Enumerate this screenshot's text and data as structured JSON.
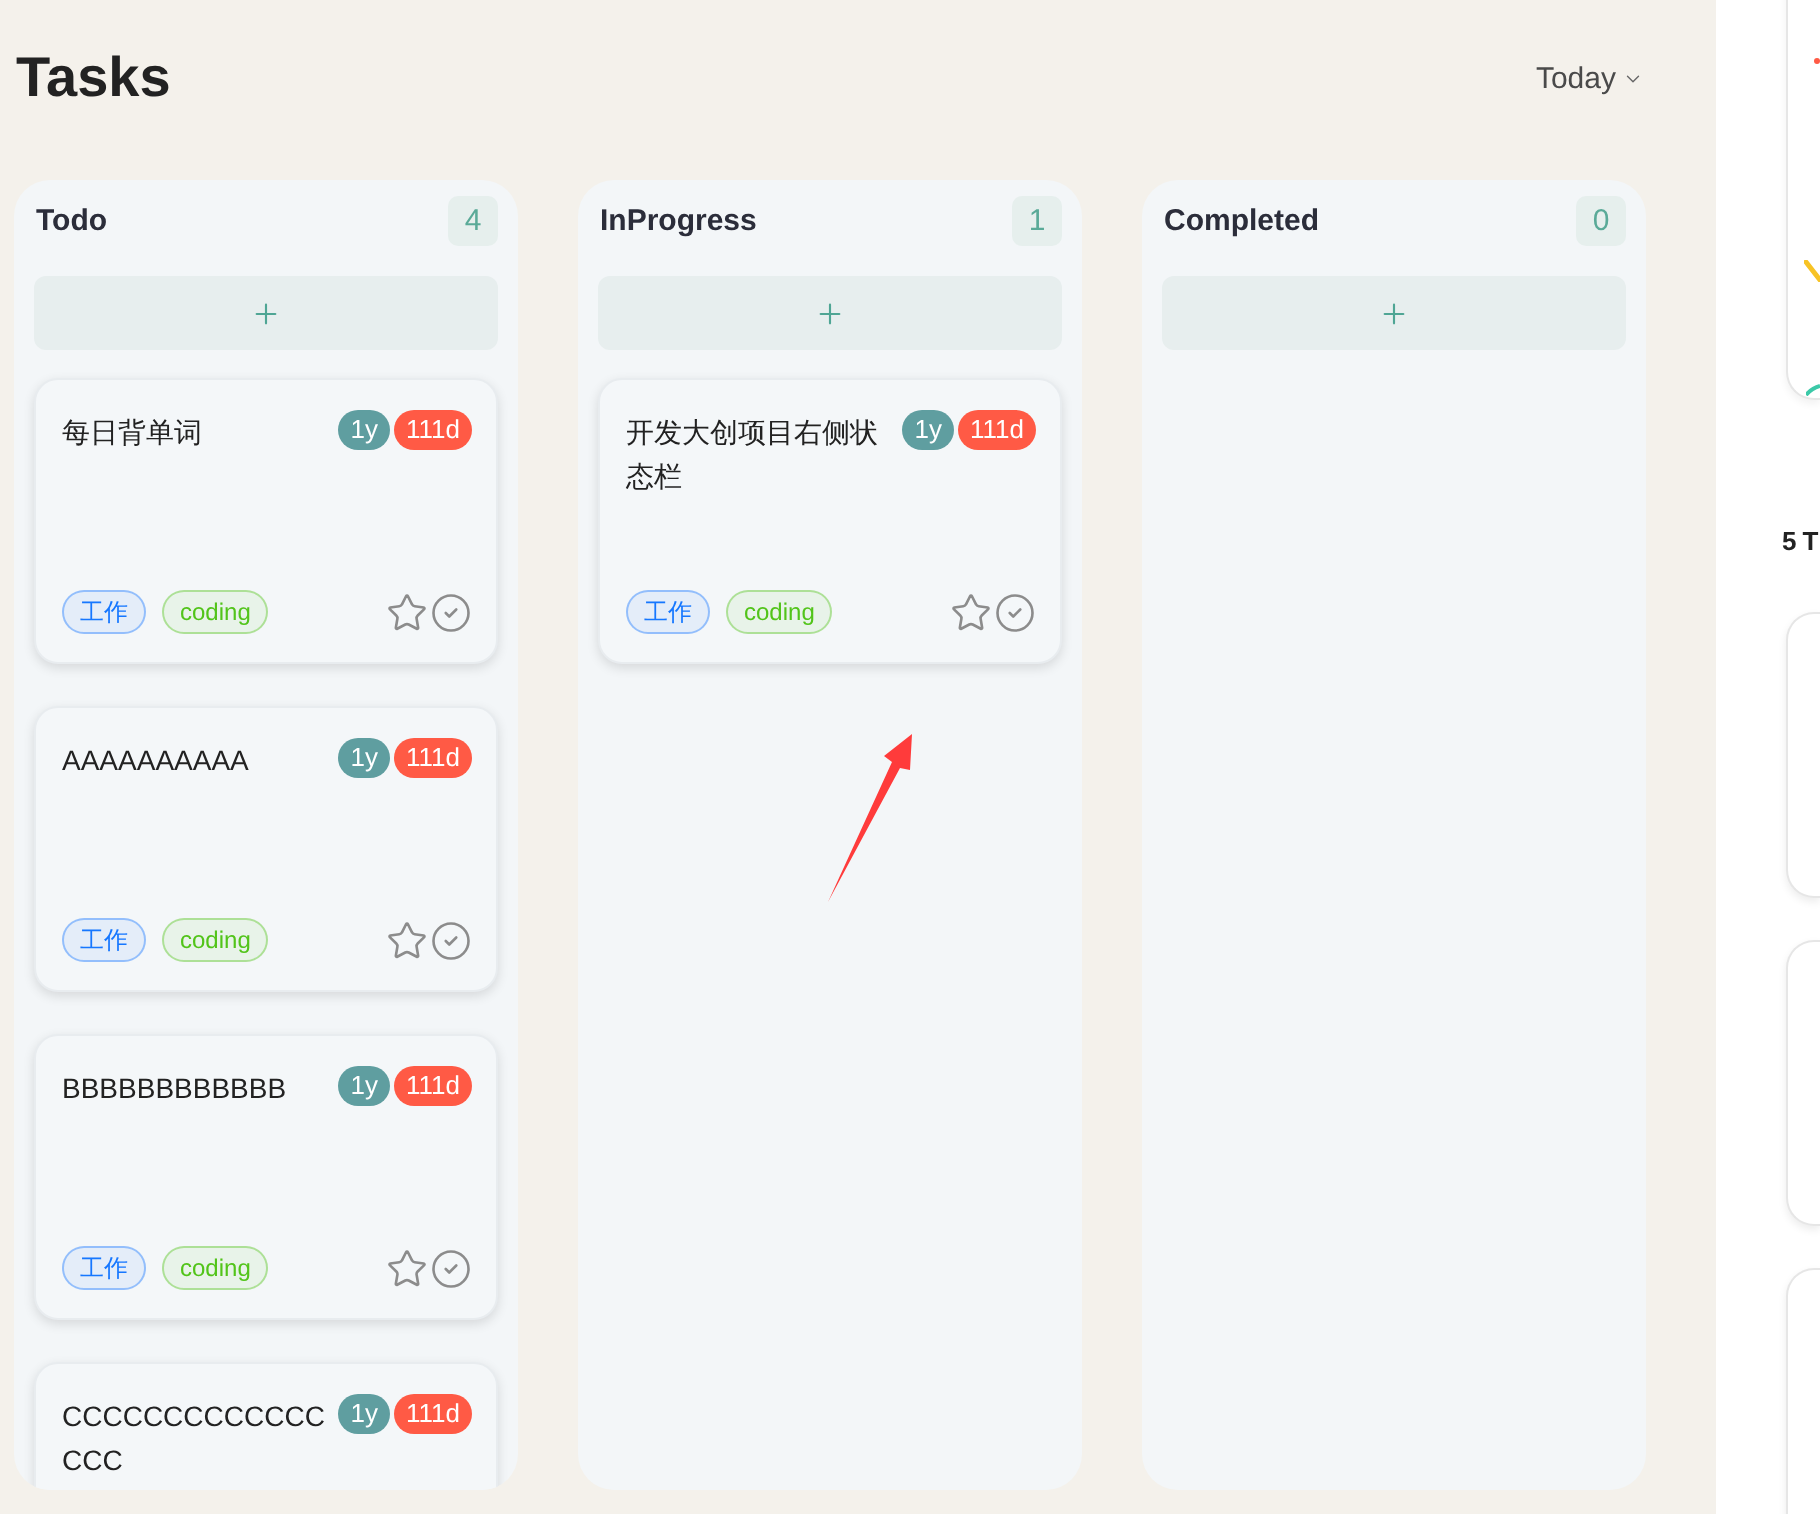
{
  "header": {
    "title": "Tasks",
    "filter": {
      "label": "Today"
    }
  },
  "columns": [
    {
      "title": "Todo",
      "count": "4",
      "cards": [
        {
          "title": "每日背单词",
          "badges": [
            {
              "text": "1y",
              "color": "#5f9ea0"
            },
            {
              "text": "111d",
              "color": "#ff5a45"
            }
          ],
          "tags": [
            {
              "label": "工作",
              "color": "#1677ff"
            },
            {
              "label": "coding",
              "color": "#52c41a"
            }
          ],
          "starred": false,
          "done": false
        },
        {
          "title": "AAAAAAAAAA",
          "badges": [
            {
              "text": "1y",
              "color": "#5f9ea0"
            },
            {
              "text": "111d",
              "color": "#ff5a45"
            }
          ],
          "tags": [
            {
              "label": "工作",
              "color": "#1677ff"
            },
            {
              "label": "coding",
              "color": "#52c41a"
            }
          ],
          "starred": false,
          "done": false
        },
        {
          "title": "BBBBBBBBBBBB",
          "badges": [
            {
              "text": "1y",
              "color": "#5f9ea0"
            },
            {
              "text": "111d",
              "color": "#ff5a45"
            }
          ],
          "tags": [
            {
              "label": "工作",
              "color": "#1677ff"
            },
            {
              "label": "coding",
              "color": "#52c41a"
            }
          ],
          "starred": false,
          "done": false
        },
        {
          "title": "CCCCCCCCCCCCCCCC",
          "badges": [
            {
              "text": "1y",
              "color": "#5f9ea0"
            },
            {
              "text": "111d",
              "color": "#ff5a45"
            }
          ]
        }
      ]
    },
    {
      "title": "InProgress",
      "count": "1",
      "cards": [
        {
          "title": "开发大创项目右侧状态栏",
          "badges": [
            {
              "text": "1y",
              "color": "#5f9ea0"
            },
            {
              "text": "111d",
              "color": "#ff5a45"
            }
          ],
          "tags": [
            {
              "label": "工作",
              "color": "#1677ff"
            },
            {
              "label": "coding",
              "color": "#52c41a"
            }
          ],
          "starred": false,
          "done": false
        }
      ]
    },
    {
      "title": "Completed",
      "count": "0"
    }
  ],
  "side_panel": {
    "heading": "5 T"
  }
}
